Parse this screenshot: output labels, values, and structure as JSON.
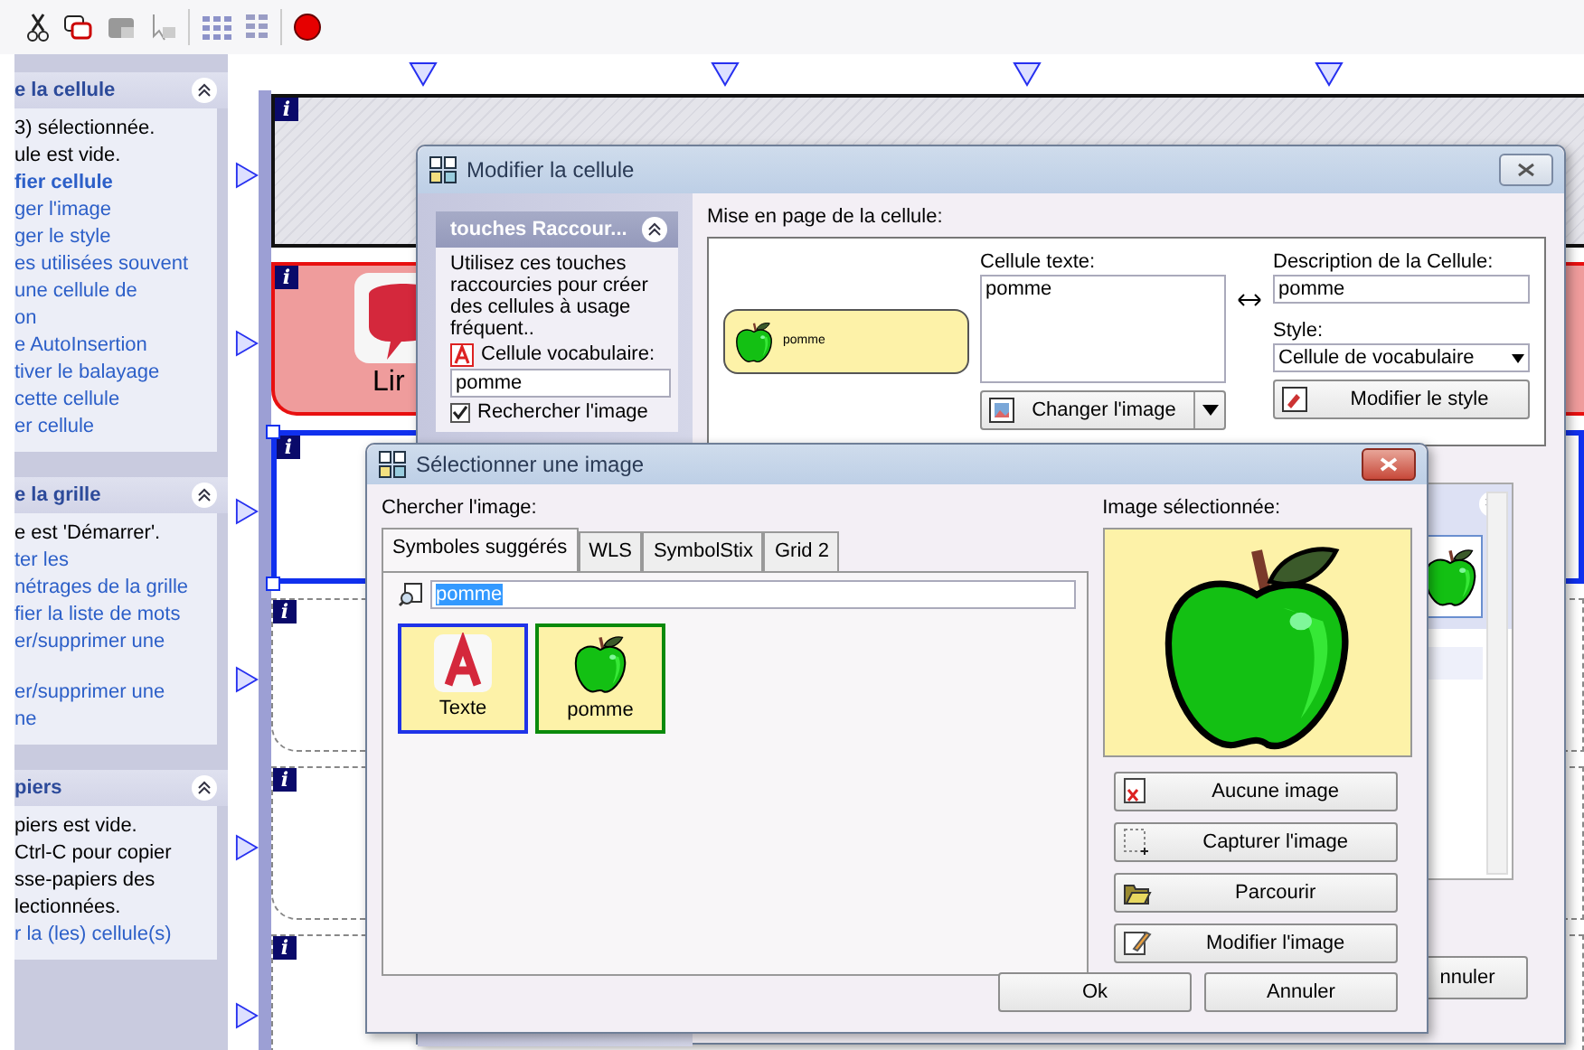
{
  "left_panel": {
    "sections": [
      {
        "title": "e la cellule",
        "lines": [
          {
            "text": "3) sélectionnée.",
            "kind": "info"
          },
          {
            "text": "ule est vide.",
            "kind": "info"
          },
          {
            "text": "fier cellule",
            "kind": "main_link"
          },
          {
            "text": "ger l'image",
            "kind": "link"
          },
          {
            "text": "ger le style",
            "kind": "link"
          },
          {
            "text": "es utilisées souvent",
            "kind": "link"
          },
          {
            "text": "une cellule de",
            "kind": "link"
          },
          {
            "text": "on",
            "kind": "link"
          },
          {
            "text": "e AutoInsertion",
            "kind": "link"
          },
          {
            "text": "tiver le balayage",
            "kind": "link"
          },
          {
            "text": "cette cellule",
            "kind": "link"
          },
          {
            "text": "er cellule",
            "kind": "link"
          }
        ]
      },
      {
        "title": "e la grille",
        "lines": [
          {
            "text": "e est 'Démarrer'.",
            "kind": "info"
          },
          {
            "text": "ter les",
            "kind": "link"
          },
          {
            "text": "nétrages de la grille",
            "kind": "link"
          },
          {
            "text": "fier la liste de mots",
            "kind": "link"
          },
          {
            "text": "er/supprimer une",
            "kind": "link"
          },
          {
            "text": "er/supprimer une",
            "kind": "gap_link"
          },
          {
            "text": "ne",
            "kind": "link"
          }
        ]
      },
      {
        "title": "piers",
        "lines": [
          {
            "text": "piers est vide.",
            "kind": "info"
          },
          {
            "text": "Ctrl-C pour copier",
            "kind": "info"
          },
          {
            "text": "sse-papiers des",
            "kind": "info"
          },
          {
            "text": "lectionnées.",
            "kind": "info"
          },
          {
            "text": "r la (les) cellule(s)",
            "kind": "link"
          }
        ]
      }
    ]
  },
  "grid": {
    "rows": [
      {
        "kind": "hatched",
        "badge": "i",
        "selected": false
      },
      {
        "kind": "pink",
        "badge": "i",
        "label": "Lir",
        "selected": false
      },
      {
        "kind": "blank",
        "badge": "i",
        "selected": true
      },
      {
        "kind": "blank",
        "badge": "i",
        "selected": false
      },
      {
        "kind": "blank",
        "badge": "i",
        "selected": false
      },
      {
        "kind": "blank",
        "badge": "i",
        "selected": false
      }
    ]
  },
  "edit_dialog": {
    "title": "Modifier la cellule",
    "shortcuts": {
      "title": "touches Raccour...",
      "description": "Utilisez ces touches raccourcies pour créer des cellules à usage fréquent..",
      "field_label": "Cellule vocabulaire:",
      "field_value": "pomme",
      "checkbox": {
        "label": "Rechercher l'image",
        "checked": true
      }
    },
    "layout_label": "Mise en page de la cellule:",
    "preview_text": "pomme",
    "text_label": "Cellule texte:",
    "text_value": "pomme",
    "description_label": "Description de la Cellule:",
    "description_value": "pomme",
    "style_label": "Style:",
    "style_value": "Cellule de vocabulaire",
    "change_image_button": "Changer l'image",
    "modify_style_button": "Modifier le style",
    "cancel_button": "nnuler"
  },
  "select_dialog": {
    "title": "Sélectionner une image",
    "search_label": "Chercher l'image:",
    "tabs": [
      {
        "label": "Symboles suggérés",
        "selected": true
      },
      {
        "label": "WLS",
        "selected": false
      },
      {
        "label": "SymbolStix",
        "selected": false
      },
      {
        "label": "Grid 2",
        "selected": false
      }
    ],
    "search_value": "pomme",
    "results": [
      {
        "kind": "text",
        "label": "Texte",
        "selected": false
      },
      {
        "kind": "apple",
        "label": "pomme",
        "selected": true
      }
    ],
    "preview_label": "Image sélectionnée:",
    "actions": [
      {
        "kind": "none",
        "label": "Aucune image"
      },
      {
        "kind": "capture",
        "label": "Capturer l'image"
      },
      {
        "kind": "browse",
        "label": "Parcourir"
      },
      {
        "kind": "edit",
        "label": "Modifier l'image"
      }
    ],
    "ok_button": "Ok",
    "cancel_button": "Annuler"
  }
}
